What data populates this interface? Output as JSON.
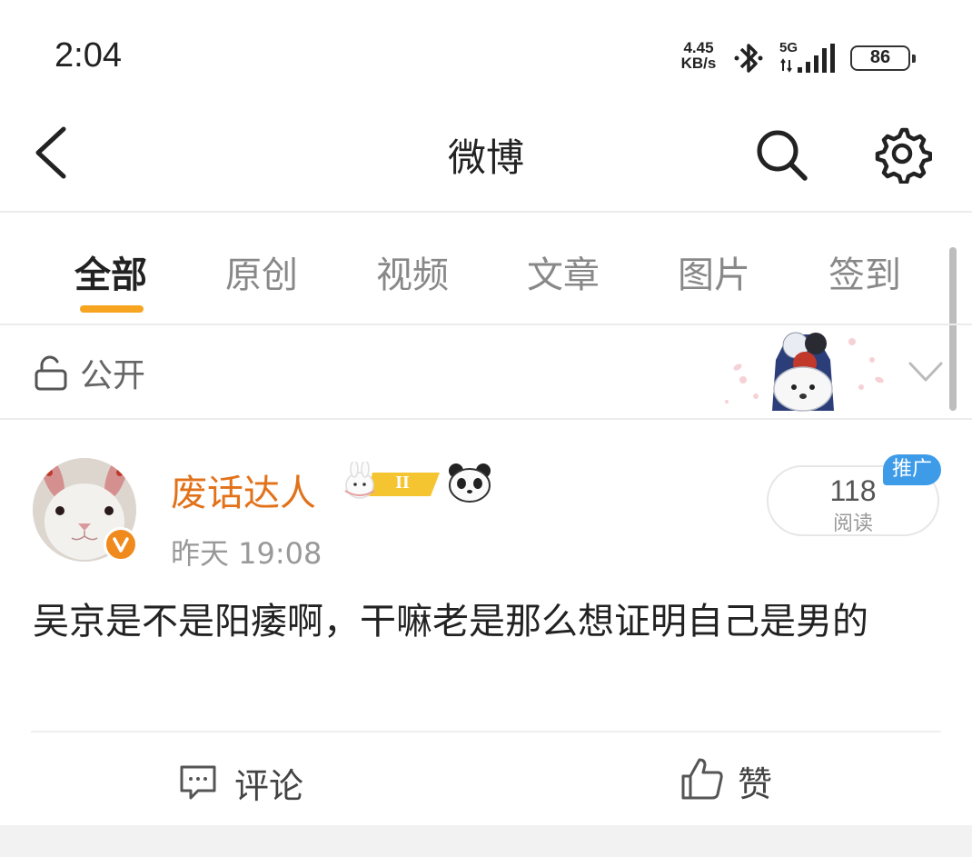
{
  "status_bar": {
    "time": "2:04",
    "net_speed_value": "4.45",
    "net_speed_unit": "KB/s",
    "network": "5G",
    "battery": "86"
  },
  "nav": {
    "title": "微博",
    "back_icon": "chevron-left-icon",
    "search_icon": "search-icon",
    "settings_icon": "gear-icon"
  },
  "tabs": [
    {
      "label": "全部",
      "active": true
    },
    {
      "label": "原创",
      "active": false
    },
    {
      "label": "视频",
      "active": false
    },
    {
      "label": "文章",
      "active": false
    },
    {
      "label": "图片",
      "active": false
    },
    {
      "label": "签到",
      "active": false
    }
  ],
  "visibility": {
    "label": "公开",
    "icon": "lock-open-icon"
  },
  "post": {
    "author": "废话达人",
    "rank_badge": "II",
    "time": "昨天 19:08",
    "read_count": "118",
    "read_label": "阅读",
    "promo_tag": "推广",
    "text": "吴京是不是阳痿啊，干嘛老是那么想证明自己是男的",
    "comment_label": "评论",
    "like_label": "赞"
  },
  "colors": {
    "accent": "#f7a520",
    "author_name": "#e2721a",
    "promo_tag": "#3d9be8",
    "verified_badge": "#f08a1c"
  }
}
